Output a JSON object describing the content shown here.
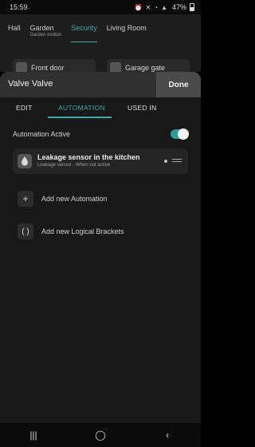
{
  "status": {
    "time": "15:59",
    "battery": "47%"
  },
  "rooms": {
    "tabs": [
      {
        "label": "Hall",
        "sub": ""
      },
      {
        "label": "Garden",
        "sub": "Garden motion"
      },
      {
        "label": "Security",
        "sub": ""
      },
      {
        "label": "Living Room",
        "sub": ""
      }
    ],
    "devices": [
      "Front door",
      "Garage gate"
    ]
  },
  "sheet": {
    "title": "Valve Valve",
    "done": "Done",
    "tabs": [
      "EDIT",
      "AUTOMATION",
      "USED IN"
    ],
    "active_tab": "AUTOMATION",
    "automation_active_label": "Automation Active",
    "automation_active": true,
    "sensor": {
      "title": "Leakage sensor in the kitchen",
      "subtitle": "Leakage sensor - When not active"
    },
    "add_automation": "Add new Automation",
    "add_brackets": "Add new Logical Brackets"
  },
  "colors": {
    "accent": "#3fa9a8"
  },
  "icons": {
    "add": "plus-icon",
    "brackets": "brackets-icon",
    "sensor": "water-drop-icon"
  }
}
